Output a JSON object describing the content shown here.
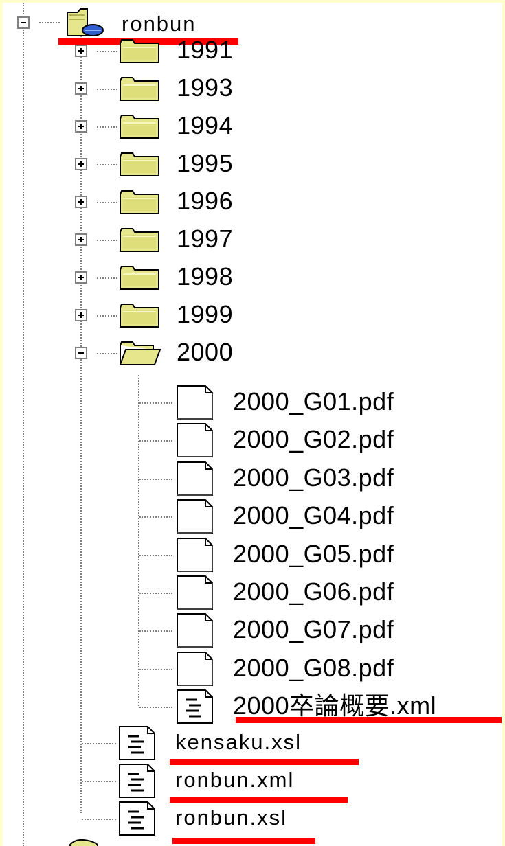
{
  "tree": {
    "root": {
      "label": "ronbun",
      "icon": "network-folder-icon",
      "expanded": true
    },
    "folders": [
      {
        "label": "1991",
        "expanded": false
      },
      {
        "label": "1993",
        "expanded": false
      },
      {
        "label": "1994",
        "expanded": false
      },
      {
        "label": "1995",
        "expanded": false
      },
      {
        "label": "1996",
        "expanded": false
      },
      {
        "label": "1997",
        "expanded": false
      },
      {
        "label": "1998",
        "expanded": false
      },
      {
        "label": "1999",
        "expanded": false
      },
      {
        "label": "2000",
        "expanded": true
      }
    ],
    "folder_2000_files": [
      {
        "label": "2000_G01.pdf",
        "icon": "blank-file-icon"
      },
      {
        "label": "2000_G02.pdf",
        "icon": "blank-file-icon"
      },
      {
        "label": "2000_G03.pdf",
        "icon": "blank-file-icon"
      },
      {
        "label": "2000_G04.pdf",
        "icon": "blank-file-icon"
      },
      {
        "label": "2000_G05.pdf",
        "icon": "blank-file-icon"
      },
      {
        "label": "2000_G06.pdf",
        "icon": "blank-file-icon"
      },
      {
        "label": "2000_G07.pdf",
        "icon": "blank-file-icon"
      },
      {
        "label": "2000_G08.pdf",
        "icon": "blank-file-icon"
      },
      {
        "label": "2000卒論概要.xml",
        "icon": "text-file-icon"
      }
    ],
    "root_files": [
      {
        "label": "kensaku.xsl",
        "icon": "text-file-icon"
      },
      {
        "label": "ronbun.xml",
        "icon": "text-file-icon"
      },
      {
        "label": "ronbun.xsl",
        "icon": "text-file-icon"
      }
    ]
  },
  "colors": {
    "background": "#ffffcc",
    "highlight_underline": "#ff0000",
    "folder_fill": "#e6e68c",
    "tree_line": "#808080"
  }
}
